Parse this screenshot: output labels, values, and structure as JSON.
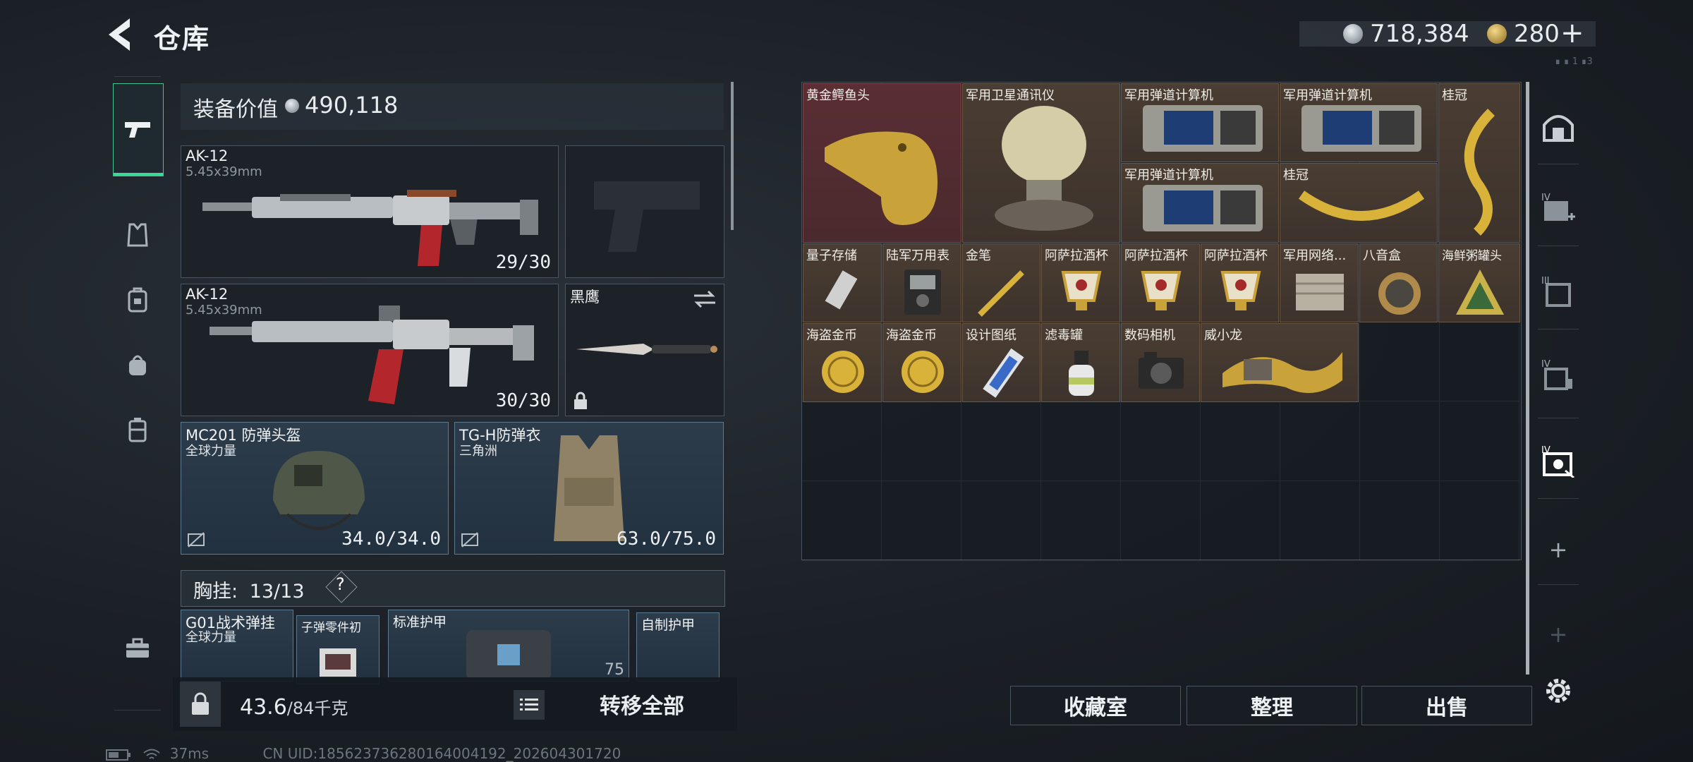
{
  "header": {
    "title": "仓库"
  },
  "currency": {
    "silver": "718,384",
    "gold": "280",
    "gold_plus": "+"
  },
  "top_right_small": "∎ ∎ 1 ∎3",
  "equipment": {
    "value_label": "装备价值",
    "value": "490,118",
    "slots": [
      {
        "name": "AK-12",
        "sub": "5.45x39mm",
        "count": "29/30"
      },
      {
        "name": "AK-12",
        "sub": "5.45x39mm",
        "count": "30/30"
      },
      {
        "name": "黑鹰",
        "sub": "",
        "count": ""
      },
      {
        "name": "MC201 防弹头盔",
        "sub": "全球力量",
        "count": "34.0/34.0"
      },
      {
        "name": "TG-H防弹衣",
        "sub": "三角洲",
        "count": "63.0/75.0"
      }
    ],
    "rig_label": "胸挂:",
    "rig_value": "13/13",
    "rig_help": "?",
    "rig_items": [
      {
        "name": "G01战术弹挂",
        "sub": "全球力量"
      },
      {
        "name": "子弹零件初"
      },
      {
        "name": "标准护甲",
        "count": "75"
      },
      {
        "name": "自制护甲"
      }
    ]
  },
  "bottom_left": {
    "weight": "43.6",
    "weight_max": "/84千克",
    "transfer_all": "转移全部"
  },
  "footer": {
    "ping": "37ms",
    "uid": "CN UID:18562373628016400419​2_202604301720"
  },
  "stash_items": [
    {
      "name": "黄金鳄鱼头"
    },
    {
      "name": "军用卫星通讯仪"
    },
    {
      "name": "军用弹道计算机"
    },
    {
      "name": "军用弹道计算机"
    },
    {
      "name": "桂冠"
    },
    {
      "name": "军用弹道计算机"
    },
    {
      "name": "桂冠"
    },
    {
      "name": "量子存储"
    },
    {
      "name": "陆军万用表"
    },
    {
      "name": "金笔"
    },
    {
      "name": "阿萨拉酒杯"
    },
    {
      "name": "阿萨拉酒杯"
    },
    {
      "name": "阿萨拉酒杯"
    },
    {
      "name": "军用网络..."
    },
    {
      "name": "八音盒"
    },
    {
      "name": "海鲜粥罐头"
    },
    {
      "name": "海盗金币"
    },
    {
      "name": "海盗金币"
    },
    {
      "name": "设计图纸"
    },
    {
      "name": "滤毒罐"
    },
    {
      "name": "数码相机"
    },
    {
      "name": "威小龙"
    }
  ],
  "stash_buttons": {
    "collection": "收藏室",
    "organize": "整理",
    "sell": "出售"
  },
  "right_sidebar": {
    "labels": [
      "IV",
      "III",
      "IV",
      "IV"
    ],
    "plus": "+"
  },
  "colors": {
    "accent_green": "#3fd79a",
    "item_brown": "#4a3d33",
    "item_red": "#5a2e33"
  }
}
